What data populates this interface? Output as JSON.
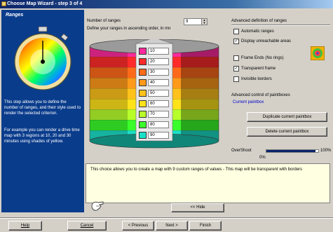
{
  "window": {
    "title": "Choose Map Wizard - step 3 of 4"
  },
  "left_panel": {
    "title": "Ranges",
    "description": "This step allows you to define the number of ranges, and their style used to render the selected criterion.",
    "example": "For example you can render a drive time map with 3 regions at 10, 20 and 30 minutes using shades of yellow."
  },
  "ranges": {
    "number_label": "Number of ranges",
    "number_value": "9",
    "define_label": "Define your ranges in ascending order, in mn",
    "values": [
      "10",
      "20",
      "30",
      "40",
      "50",
      "60",
      "70",
      "80",
      "90"
    ],
    "colors": [
      "#ff2a9e",
      "#ff2a2a",
      "#ff6a1a",
      "#ff9a1a",
      "#ffc21a",
      "#ffe21a",
      "#b8ff2a",
      "#3aff2a",
      "#1ae0c8"
    ]
  },
  "advanced": {
    "group_title": "Advanced definition of ranges",
    "automatic_ranges": {
      "label": "Automatic ranges",
      "checked": false
    },
    "display_unreachable": {
      "label": "Display unreachable areas",
      "checked": true
    },
    "frame_ends": {
      "label": "Frame Ends (No rings)",
      "checked": false
    },
    "transparent_frame": {
      "label": "Transparent frame",
      "checked": true
    },
    "invisible_borders": {
      "label": "Invisible borders",
      "checked": false
    }
  },
  "paintboxes": {
    "group_title": "Advanced control of paintboxes",
    "current_label": "Current paintbox",
    "duplicate_button": "Duplicate current paintbox",
    "delete_button": "Delete current paintbox"
  },
  "overshoot": {
    "label": "OverShoot",
    "min": "0%",
    "max": "100%",
    "value": 0.95
  },
  "comment": {
    "text": "This choice allows you to create a map with 9 custom ranges of values - This map will be transparent with borders"
  },
  "hide_button": "<< Hide",
  "footer": {
    "help": "Help",
    "cancel": "Cancel",
    "previous": "< Previous",
    "next": "Next >",
    "finish": "Finish"
  }
}
